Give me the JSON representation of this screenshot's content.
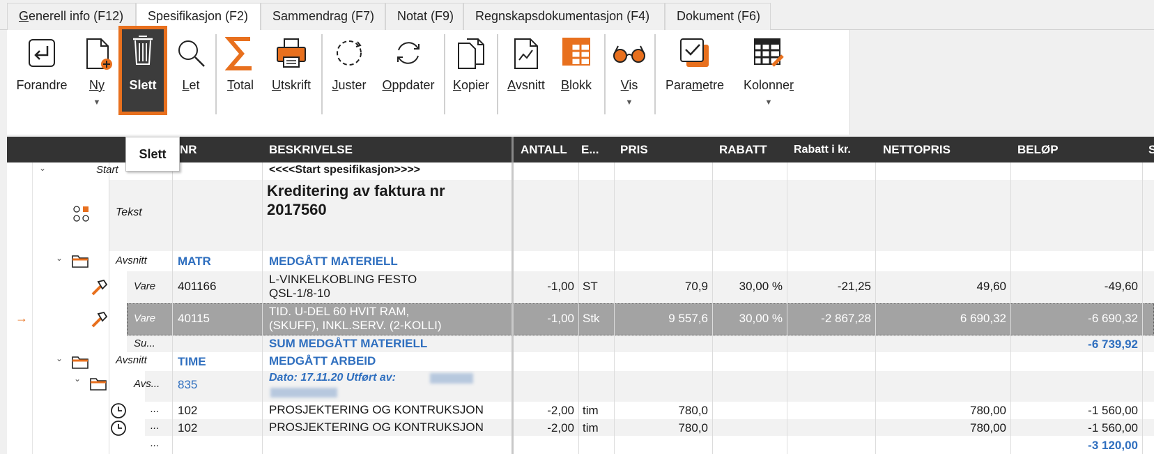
{
  "tabs": [
    {
      "pre": "",
      "u": "G",
      "post": "enerell info (F12)"
    },
    {
      "pre": "Spesifikasjon (F2)",
      "u": "",
      "post": ""
    },
    {
      "pre": "Sammendrag (F7)",
      "u": "",
      "post": ""
    },
    {
      "pre": "Notat (F9)",
      "u": "",
      "post": ""
    },
    {
      "pre": "Regnskapsdokumentasjon (F4)",
      "u": "",
      "post": ""
    },
    {
      "pre": "Dokument (F6)",
      "u": "",
      "post": ""
    }
  ],
  "ribbon": {
    "forandre": {
      "pre": "Forandre",
      "u": "",
      "post": ""
    },
    "ny": {
      "pre": "",
      "u": "Ny",
      "post": ""
    },
    "slett": {
      "pre": "Slett",
      "u": "",
      "post": ""
    },
    "let": {
      "pre": "",
      "u": "L",
      "post": "et"
    },
    "total": {
      "pre": "",
      "u": "T",
      "post": "otal"
    },
    "utskrift": {
      "pre": "",
      "u": "U",
      "post": "tskrift"
    },
    "juster": {
      "pre": "",
      "u": "J",
      "post": "uster"
    },
    "oppdater": {
      "pre": "",
      "u": "O",
      "post": "ppdater"
    },
    "kopier": {
      "pre": "",
      "u": "K",
      "post": "opier"
    },
    "avsnitt": {
      "pre": "",
      "u": "A",
      "post": "vsnitt"
    },
    "blokk": {
      "pre": "",
      "u": "B",
      "post": "lokk"
    },
    "vis": {
      "pre": "",
      "u": "V",
      "post": "is"
    },
    "parametre": {
      "pre": "Para",
      "u": "m",
      "post": "etre"
    },
    "kolonner": {
      "pre": "Kolonne",
      "u": "r",
      "post": ""
    },
    "accent_color": "#e8701e",
    "selected_bg": "#3c3c3c"
  },
  "tooltip": "Slett",
  "columns": {
    "nr": "NR",
    "beskrivelse": "BESKRIVELSE",
    "antall": "ANTALL",
    "enhet": "E...",
    "pris": "PRIS",
    "rabatt": "RABATT",
    "rabatt_kr": "Rabatt i kr.",
    "nettopris": "NETTOPRIS",
    "belop": "BELØP",
    "extra": "S"
  },
  "rows": {
    "start": {
      "type": "Start",
      "desc": "<<<<Start spesifikasjon>>>>"
    },
    "tekst": {
      "type": "Tekst",
      "desc1": "Kreditering av faktura nr",
      "desc2": "2017560"
    },
    "avsnitt_matr": {
      "type": "Avsnitt",
      "nr": "MATR",
      "desc": "MEDGÅTT MATERIELL"
    },
    "vare1": {
      "type": "Vare",
      "nr": "401166",
      "desc1": "L-VINKELKOBLING FESTO",
      "desc2": "QSL-1/8-10",
      "antall": "-1,00",
      "enhet": "ST",
      "pris": "70,9",
      "rabatt": "30,00 %",
      "rabatt_kr": "-21,25",
      "nettopris": "49,60",
      "belop": "-49,60"
    },
    "vare2": {
      "type": "Vare",
      "nr": "40115",
      "desc1": "TID. U-DEL 60 HVIT RAM,",
      "desc2": "(SKUFF), INKL.SERV. (2-KOLLI)",
      "antall": "-1,00",
      "enhet": "Stk",
      "pris": "9 557,6",
      "rabatt": "30,00 %",
      "rabatt_kr": "-2 867,28",
      "nettopris": "6 690,32",
      "belop": "-6 690,32",
      "arrow": "→"
    },
    "sum1": {
      "type": "Su...",
      "desc": "SUM MEDGÅTT MATERIELL",
      "belop": "-6 739,92"
    },
    "avsnitt_time": {
      "type": "Avsnitt",
      "nr": "TIME",
      "desc": "MEDGÅTT ARBEID"
    },
    "avs835": {
      "type": "Avs...",
      "nr": "835",
      "desc": "Dato: 17.11.20  Utført av:"
    },
    "time1": {
      "type": "...",
      "nr": "102",
      "desc": "PROSJEKTERING OG KONTRUKSJON",
      "antall": "-2,00",
      "enhet": "tim",
      "pris": "780,0",
      "nettopris": "780,00",
      "belop": "-1 560,00"
    },
    "time2": {
      "type": "...",
      "nr": "102",
      "desc": "PROSJEKTERING OG KONTRUKSJON",
      "antall": "-2,00",
      "enhet": "tim",
      "pris": "780,0",
      "nettopris": "780,00",
      "belop": "-1 560,00"
    },
    "sum2": {
      "type": "...",
      "belop": "-3 120,00"
    }
  }
}
